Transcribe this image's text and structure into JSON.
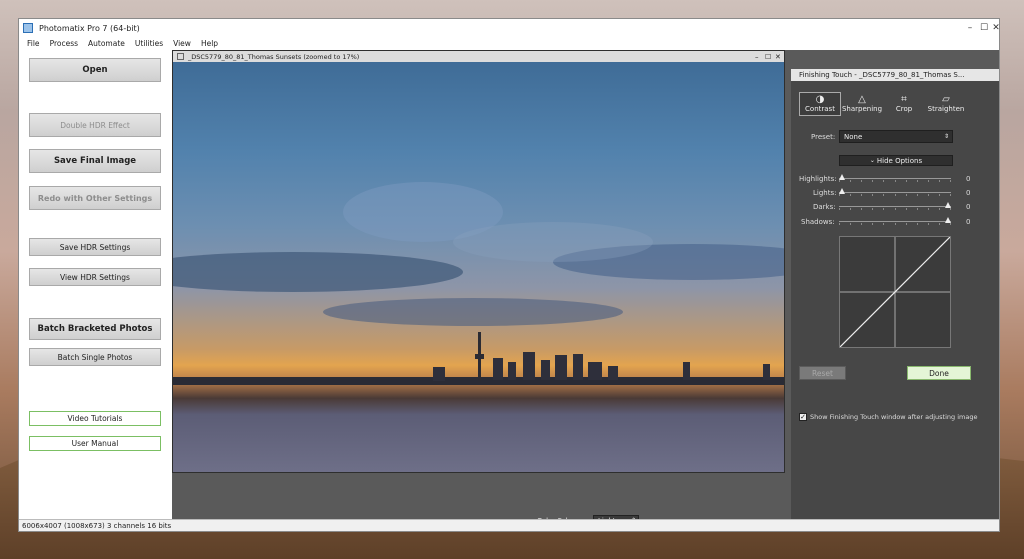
{
  "window": {
    "title": "Photomatix Pro 7  (64-bit)"
  },
  "menu": [
    "File",
    "Process",
    "Automate",
    "Utilities",
    "View",
    "Help"
  ],
  "left": {
    "open": "Open",
    "double_hdr": "Double HDR Effect",
    "save_final": "Save Final Image",
    "redo": "Redo with Other Settings",
    "save_hdr": "Save HDR Settings",
    "view_hdr": "View HDR Settings",
    "batch_bracketed": "Batch Bracketed Photos",
    "batch_single": "Batch Single Photos",
    "video_tutorials": "Video Tutorials",
    "user_manual": "User Manual"
  },
  "image_window": {
    "title": "_DSC5779_80_81_Thomas Sunsets (zoomed to 17%)"
  },
  "color_scheme": {
    "label": "Color Scheme:",
    "value": "Light"
  },
  "finishing": {
    "title": "Finishing Touch - _DSC5779_80_81_Thomas S...",
    "tools": [
      {
        "label": "Contrast",
        "icon": "◑"
      },
      {
        "label": "Sharpening",
        "icon": "△"
      },
      {
        "label": "Crop",
        "icon": "⌗"
      },
      {
        "label": "Straighten",
        "icon": "▱"
      }
    ],
    "preset_label": "Preset:",
    "preset_value": "None",
    "hide_options": "Hide Options",
    "sliders": [
      {
        "label": "Highlights:",
        "value": "0",
        "pos": 0
      },
      {
        "label": "Lights:",
        "value": "0",
        "pos": 0
      },
      {
        "label": "Darks:",
        "value": "0",
        "pos": 1
      },
      {
        "label": "Shadows:",
        "value": "0",
        "pos": 1
      }
    ],
    "reset": "Reset",
    "done": "Done",
    "show_checkbox": "Show Finishing Touch window after adjusting image"
  },
  "status": "6006x4007 (1008x673) 3 channels 16 bits"
}
